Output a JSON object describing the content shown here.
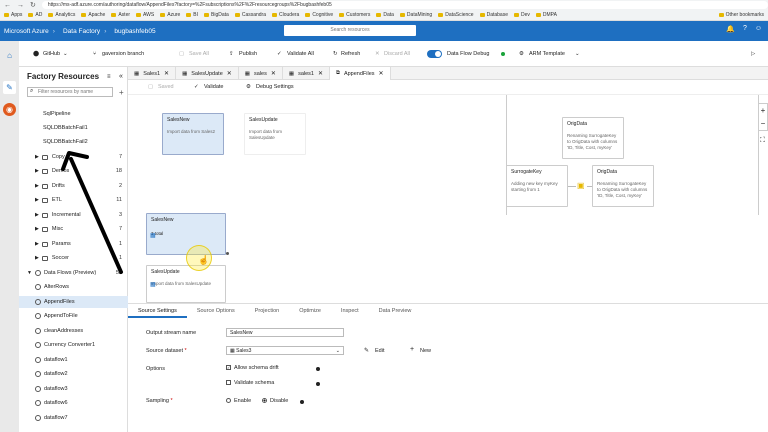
{
  "browser": {
    "url": "https://ms-adf.azure.com/authoring/dataflow/AppendFiles?factory=%2Fsubscriptions%2F%2Fresourcegroups%2Fbugbashfeb05",
    "bookmarks": [
      "Apps",
      "AD",
      "Analytics",
      "Apache",
      "Aster",
      "AWS",
      "Azure",
      "BI",
      "BigData",
      "Cassandra",
      "Cloudera",
      "Cognitive",
      "Customers",
      "Data",
      "DataMining",
      "DataScience",
      "Database",
      "Dev",
      "DMPA"
    ],
    "other_bookmarks": "Other bookmarks"
  },
  "topbar": {
    "product": "Microsoft Azure",
    "service": "Data Factory",
    "factory": "bugbashfeb05",
    "search_placeholder": "Search resources"
  },
  "toolbar": {
    "repo": "GitHub",
    "branch": "gaversion branch",
    "save_all": "Save All",
    "publish": "Publish",
    "validate_all": "Validate All",
    "refresh": "Refresh",
    "discard_all": "Discard All",
    "data_flow_debug": "Data Flow Debug",
    "arm_template": "ARM Template"
  },
  "panel": {
    "title": "Factory Resources",
    "filter_placeholder": "Filter resources by name",
    "items_top": [
      "SqlPipeline",
      "SQLDBBatchFail1",
      "SQLDBBatchFail2"
    ],
    "folders": [
      {
        "name": "Copy",
        "count": "7"
      },
      {
        "name": "Demos",
        "count": "18"
      },
      {
        "name": "Drifts",
        "count": "2"
      },
      {
        "name": "ETL",
        "count": "11"
      },
      {
        "name": "Incremental",
        "count": "3"
      },
      {
        "name": "Misc",
        "count": "7"
      },
      {
        "name": "Params",
        "count": "1"
      },
      {
        "name": "Soccer",
        "count": "1"
      }
    ],
    "dataflows_label": "Data Flows (Preview)",
    "dataflows_count": "52",
    "dataflows": [
      "AlterRows",
      "AppendFiles",
      "AppendToFile",
      "cleanAddresses",
      "Currency Converter1",
      "dataflow1",
      "dataflow2",
      "dataflow3",
      "dataflow6",
      "dataflow7"
    ]
  },
  "tabs": [
    {
      "label": "Sales1"
    },
    {
      "label": "SalesUpdate"
    },
    {
      "label": "sales"
    },
    {
      "label": "sales1"
    },
    {
      "label": "AppendFiles"
    }
  ],
  "subbar": {
    "saved": "Saved",
    "validate": "Validate",
    "debug_settings": "Debug Settings"
  },
  "canvas": {
    "node_salesnew": {
      "title": "SalesNew",
      "desc": "Import data from Sales2"
    },
    "node_salesupdate": {
      "title": "SalesUpdate",
      "desc": "Import data from SalesUpdate"
    },
    "node_orig_top": {
      "title": "OrigData",
      "desc": "Renaming SurrogateKey to OrigData with columns 'ID, Title, Cost, myKey'"
    },
    "node_surrogate": {
      "title": "SurrogateKey",
      "desc": "Adding new key myKey starting from 1"
    },
    "node_orig_mid": {
      "title": "OrigData",
      "desc": "Renaming SurrogateKey to OrigData with columns 'ID, Title, Cost, myKey'"
    },
    "node_salesnew2": {
      "title": "SalesNew",
      "desc": "3 total"
    },
    "node_salesupdate2": {
      "title": "SalesUpdate",
      "desc": "Import data from SalesUpdate"
    }
  },
  "bottom": {
    "tabs": [
      "Source Settings",
      "Source Options",
      "Projection",
      "Optimize",
      "Inspect",
      "Data Preview"
    ],
    "output_stream_label": "Output stream name",
    "output_stream_value": "SalesNew",
    "source_dataset_label": "Source dataset",
    "source_dataset_value": "Sales3",
    "edit": "Edit",
    "new": "New",
    "options_label": "Options",
    "allow_schema_drift": "Allow schema drift",
    "validate_schema": "Validate schema",
    "sampling_label": "Sampling",
    "enable": "Enable",
    "disable": "Disable"
  },
  "colors": {
    "azure_blue": "#1e6fc1",
    "selected_bg": "#dce9f7"
  }
}
